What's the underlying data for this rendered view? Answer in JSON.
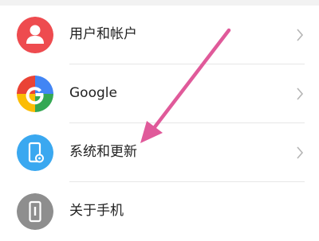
{
  "settings": {
    "items": [
      {
        "label": "用户和帐户",
        "icon": "user-account-icon",
        "icon_color": "#ee4b4f"
      },
      {
        "label": "Google",
        "icon": "google-icon",
        "icon_color": "#4285f4"
      },
      {
        "label": "系统和更新",
        "icon": "system-update-icon",
        "icon_color": "#3aa8f0"
      },
      {
        "label": "关于手机",
        "icon": "about-phone-icon",
        "icon_color": "#8e8e8e"
      }
    ]
  },
  "annotation": {
    "arrow_color": "#e05a9a",
    "points_to": "系统和更新"
  }
}
